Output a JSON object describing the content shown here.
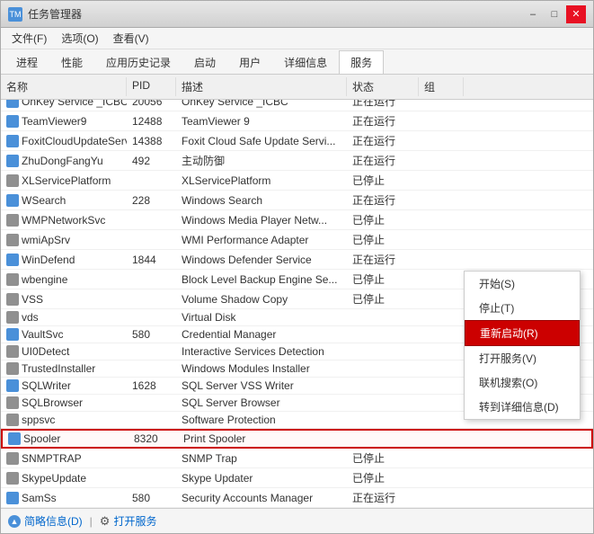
{
  "window": {
    "title": "任务管理器",
    "icon": "TM"
  },
  "titleControls": {
    "minimize": "–",
    "maximize": "□",
    "close": "✕"
  },
  "menuBar": {
    "items": [
      "文件(F)",
      "选项(O)",
      "查看(V)"
    ]
  },
  "tabs": [
    {
      "label": "进程"
    },
    {
      "label": "性能"
    },
    {
      "label": "应用历史记录"
    },
    {
      "label": "启动"
    },
    {
      "label": "用户"
    },
    {
      "label": "详细信息"
    },
    {
      "label": "服务",
      "active": true
    }
  ],
  "tableHeaders": [
    "名称",
    "PID",
    "描述",
    "状态",
    "组"
  ],
  "services": [
    {
      "name": "OnKey Service _ICBC",
      "pid": "20056",
      "desc": "OnKey Service _ICBC",
      "status": "正在运行",
      "group": "",
      "icon": "blue"
    },
    {
      "name": "TeamViewer9",
      "pid": "12488",
      "desc": "TeamViewer 9",
      "status": "正在运行",
      "group": "",
      "icon": "blue"
    },
    {
      "name": "FoxitCloudUpdateService",
      "pid": "14388",
      "desc": "Foxit Cloud Safe Update Servi...",
      "status": "正在运行",
      "group": "",
      "icon": "blue"
    },
    {
      "name": "ZhuDongFangYu",
      "pid": "492",
      "desc": "主动防御",
      "status": "正在运行",
      "group": "",
      "icon": "blue"
    },
    {
      "name": "XLServicePlatform",
      "pid": "",
      "desc": "XLServicePlatform",
      "status": "已停止",
      "group": "",
      "icon": "gray"
    },
    {
      "name": "WSearch",
      "pid": "228",
      "desc": "Windows Search",
      "status": "正在运行",
      "group": "",
      "icon": "blue"
    },
    {
      "name": "WMPNetworkSvc",
      "pid": "",
      "desc": "Windows Media Player Netw...",
      "status": "已停止",
      "group": "",
      "icon": "gray"
    },
    {
      "name": "wmiApSrv",
      "pid": "",
      "desc": "WMI Performance Adapter",
      "status": "已停止",
      "group": "",
      "icon": "gray"
    },
    {
      "name": "WinDefend",
      "pid": "1844",
      "desc": "Windows Defender Service",
      "status": "正在运行",
      "group": "",
      "icon": "blue"
    },
    {
      "name": "wbengine",
      "pid": "",
      "desc": "Block Level Backup Engine Se...",
      "status": "已停止",
      "group": "",
      "icon": "gray"
    },
    {
      "name": "VSS",
      "pid": "",
      "desc": "Volume Shadow Copy",
      "status": "已停止",
      "group": "",
      "icon": "gray"
    },
    {
      "name": "vds",
      "pid": "",
      "desc": "Virtual Disk",
      "status": "",
      "group": "",
      "icon": "gray"
    },
    {
      "name": "VaultSvc",
      "pid": "580",
      "desc": "Credential Manager",
      "status": "",
      "group": "",
      "icon": "blue"
    },
    {
      "name": "UI0Detect",
      "pid": "",
      "desc": "Interactive Services Detection",
      "status": "",
      "group": "",
      "icon": "gray"
    },
    {
      "name": "TrustedInstaller",
      "pid": "",
      "desc": "Windows Modules Installer",
      "status": "",
      "group": "",
      "icon": "gray"
    },
    {
      "name": "SQLWriter",
      "pid": "1628",
      "desc": "SQL Server VSS Writer",
      "status": "",
      "group": "",
      "icon": "blue"
    },
    {
      "name": "SQLBrowser",
      "pid": "",
      "desc": "SQL Server Browser",
      "status": "",
      "group": "",
      "icon": "gray"
    },
    {
      "name": "sppsvc",
      "pid": "",
      "desc": "Software Protection",
      "status": "",
      "group": "",
      "icon": "gray"
    },
    {
      "name": "Spooler",
      "pid": "8320",
      "desc": "Print Spooler",
      "status": "",
      "group": "",
      "icon": "blue",
      "highlight": true
    },
    {
      "name": "SNMPTRAP",
      "pid": "",
      "desc": "SNMP Trap",
      "status": "已停止",
      "group": "",
      "icon": "gray"
    },
    {
      "name": "SkypeUpdate",
      "pid": "",
      "desc": "Skype Updater",
      "status": "已停止",
      "group": "",
      "icon": "gray"
    },
    {
      "name": "SamSs",
      "pid": "580",
      "desc": "Security Accounts Manager",
      "status": "正在运行",
      "group": "",
      "icon": "blue"
    }
  ],
  "contextMenu": {
    "items": [
      {
        "label": "开始(S)",
        "type": "normal"
      },
      {
        "label": "停止(T)",
        "type": "normal"
      },
      {
        "label": "重新启动(R)",
        "type": "active"
      },
      {
        "label": "打开服务(V)",
        "type": "normal"
      },
      {
        "label": "联机搜索(O)",
        "type": "normal"
      },
      {
        "label": "转到详细信息(D)",
        "type": "normal"
      }
    ]
  },
  "statusBar": {
    "info": "简略信息(D)",
    "services": "打开服务"
  }
}
